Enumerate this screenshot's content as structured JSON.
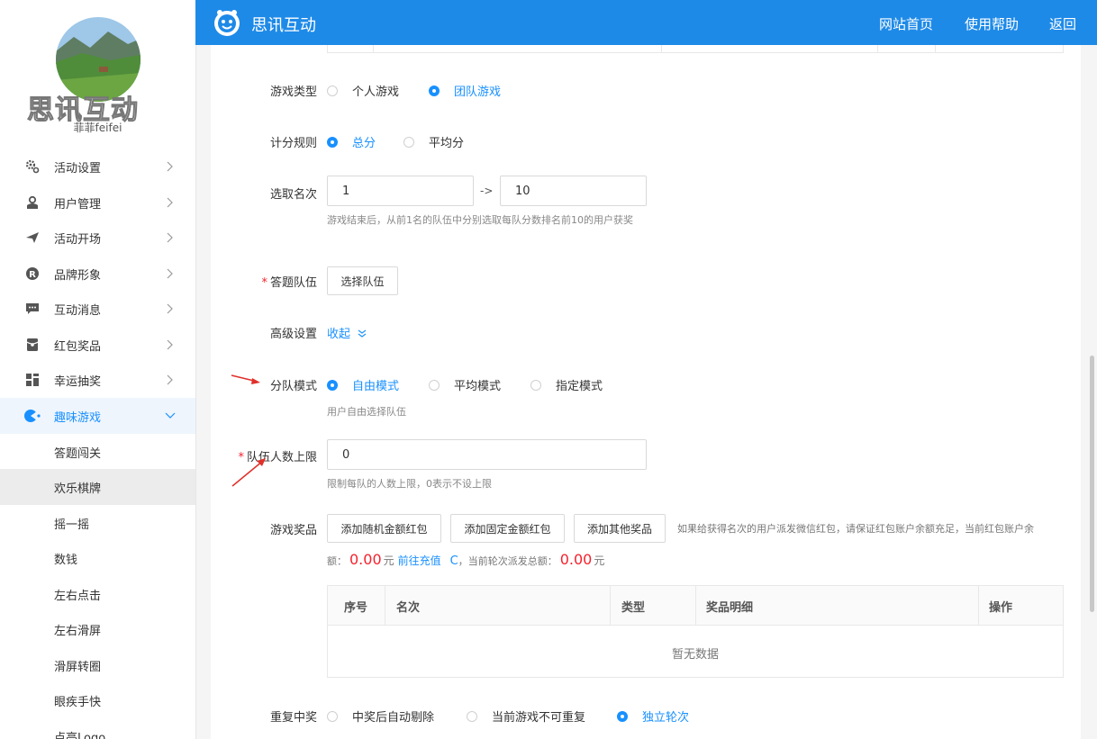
{
  "header": {
    "app_title": "思讯互动",
    "links": [
      "网站首页",
      "使用帮助",
      "返回"
    ]
  },
  "sidebar": {
    "brand_mark": "思讯互动",
    "username": "菲菲feifei",
    "items": [
      {
        "label": "活动设置",
        "icon": "gear-icon"
      },
      {
        "label": "用户管理",
        "icon": "user-icon"
      },
      {
        "label": "活动开场",
        "icon": "paper-plane-icon"
      },
      {
        "label": "品牌形象",
        "icon": "registered-icon"
      },
      {
        "label": "互动消息",
        "icon": "message-icon"
      },
      {
        "label": "红包奖品",
        "icon": "red-packet-icon"
      },
      {
        "label": "幸运抽奖",
        "icon": "lottery-icon"
      },
      {
        "label": "趣味游戏",
        "icon": "game-icon",
        "active": true
      }
    ],
    "subitems": [
      "答题闯关",
      "欢乐棋牌",
      "摇一摇",
      "数钱",
      "左右点击",
      "左右滑屏",
      "滑屏转圈",
      "眼疾手快",
      "点亮Logo"
    ],
    "current_subitem": "欢乐棋牌"
  },
  "form": {
    "game_type": {
      "label": "游戏类型",
      "options": [
        "个人游戏",
        "团队游戏"
      ],
      "selected": "团队游戏"
    },
    "score_rule": {
      "label": "计分规则",
      "options": [
        "总分",
        "平均分"
      ],
      "selected": "总分"
    },
    "rank_range": {
      "label": "选取名次",
      "from": "1",
      "separator": "->",
      "to": "10",
      "hint": "游戏结束后，从前1名的队伍中分别选取每队分数排名前10的用户获奖"
    },
    "teams": {
      "label": "答题队伍",
      "button": "选择队伍"
    },
    "advanced": {
      "label": "高级设置",
      "toggle": "收起"
    },
    "team_mode": {
      "label": "分队模式",
      "options": [
        "自由模式",
        "平均模式",
        "指定模式"
      ],
      "selected": "自由模式",
      "hint": "用户自由选择队伍"
    },
    "team_limit": {
      "label": "队伍人数上限",
      "value": "0",
      "hint": "限制每队的人数上限，0表示不设上限"
    },
    "prizes": {
      "label": "游戏奖品",
      "buttons": [
        "添加随机金额红包",
        "添加固定金额红包",
        "添加其他奖品"
      ],
      "note": "如果给获得名次的用户派发微信红包，请保证红包账户余额充足，当前红包账户余",
      "balance_prefix": "额：",
      "balance": "0.00",
      "unit": "元",
      "recharge": "前往充值",
      "round_total_label": "，当前轮次派发总额：",
      "round_total": "0.00",
      "unit2": "元"
    },
    "prize_table": {
      "columns": [
        "序号",
        "名次",
        "类型",
        "奖品明细",
        "操作"
      ],
      "empty_text": "暂无数据"
    },
    "repeat_win": {
      "label": "重复中奖",
      "options": [
        "中奖后自动剔除",
        "当前游戏不可重复",
        "独立轮次"
      ],
      "selected": "独立轮次"
    }
  },
  "colors": {
    "accent": "#1890ff",
    "header": "#1e8ae8",
    "required": "#f5222d"
  }
}
